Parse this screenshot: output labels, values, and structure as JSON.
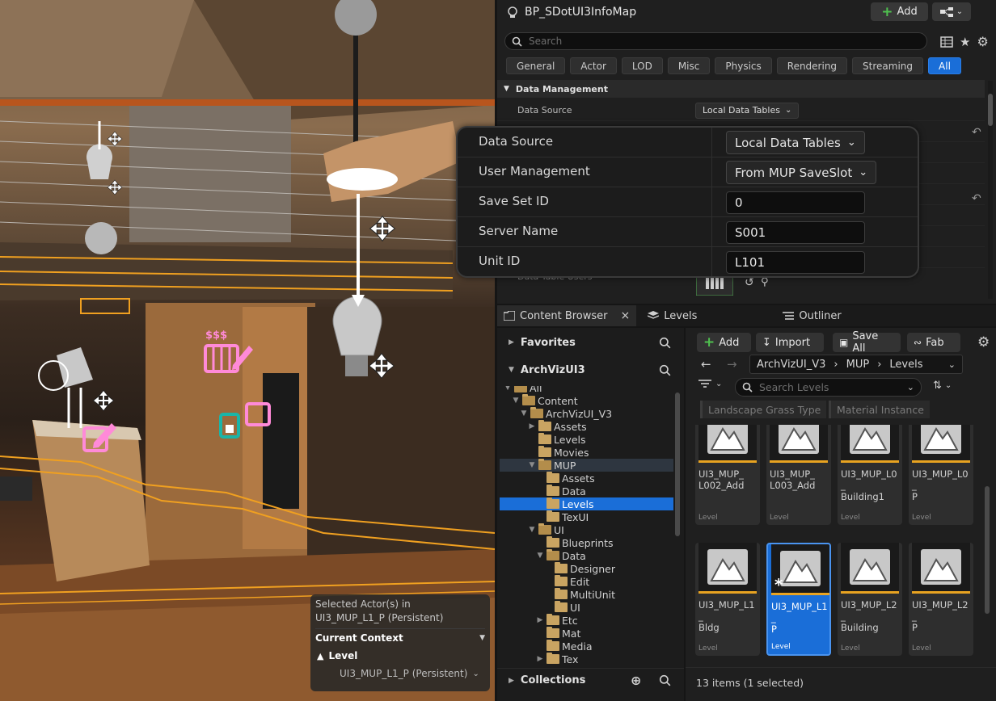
{
  "viewport": {
    "selected_actors_label": "Selected Actor(s) in",
    "selected_actors_level": "UI3_MUP_L1_P (Persistent)",
    "current_context": "Current Context",
    "level_label": "Level",
    "level_value": "UI3_MUP_L1_P (Persistent)",
    "overlay_text_money": "$$$",
    "overlay_text_dollar": "$"
  },
  "details": {
    "title": "BP_SDotUI3InfoMap",
    "add_label": "Add",
    "search_placeholder": "Search",
    "tabs": [
      {
        "label": "General"
      },
      {
        "label": "Actor"
      },
      {
        "label": "LOD"
      },
      {
        "label": "Misc"
      },
      {
        "label": "Physics"
      },
      {
        "label": "Rendering"
      },
      {
        "label": "Streaming"
      },
      {
        "label": "All"
      }
    ],
    "active_tab": "All",
    "section": "Data Management",
    "rows": [
      {
        "name": "Data Source",
        "value": "Local Data Tables"
      }
    ],
    "partial_row": "Data Table Users"
  },
  "zoom": {
    "rows": [
      {
        "label": "Data Source",
        "value": "Local Data Tables",
        "kind": "dropdown"
      },
      {
        "label": "User Management",
        "value": "From MUP SaveSlot",
        "kind": "dropdown"
      },
      {
        "label": "Save Set ID",
        "value": "0",
        "kind": "input"
      },
      {
        "label": "Server Name",
        "value": "S001",
        "kind": "input"
      },
      {
        "label": "Unit ID",
        "value": "L101",
        "kind": "input"
      }
    ]
  },
  "bottom_tabs": {
    "content_browser": "Content Browser",
    "levels": "Levels",
    "outliner": "Outliner"
  },
  "content_browser": {
    "favorites": "Favorites",
    "project": "ArchVizUI3",
    "collections": "Collections",
    "add_label": "Add",
    "import_label": "Import",
    "save_all_label": "Save All",
    "fab_label": "Fab",
    "path": [
      "ArchVizUI_V3",
      "MUP",
      "Levels"
    ],
    "search_placeholder": "Search Levels",
    "filters": [
      "Landscape Grass Type",
      "Material Instance"
    ],
    "tree": [
      {
        "label": "All",
        "depth": 0,
        "open": true
      },
      {
        "label": "Content",
        "depth": 1,
        "open": true
      },
      {
        "label": "ArchVizUI_V3",
        "depth": 2,
        "open": true
      },
      {
        "label": "Assets",
        "depth": 3,
        "open": false,
        "expandable": true
      },
      {
        "label": "Levels",
        "depth": 3,
        "open": false
      },
      {
        "label": "Movies",
        "depth": 3,
        "open": false
      },
      {
        "label": "MUP",
        "depth": 3,
        "open": true,
        "hover": true
      },
      {
        "label": "Assets",
        "depth": 4,
        "open": false
      },
      {
        "label": "Data",
        "depth": 4,
        "open": false
      },
      {
        "label": "Levels",
        "depth": 4,
        "open": false,
        "selected": true
      },
      {
        "label": "TexUI",
        "depth": 4,
        "open": false
      },
      {
        "label": "UI",
        "depth": 3,
        "open": true
      },
      {
        "label": "Blueprints",
        "depth": 4,
        "open": false
      },
      {
        "label": "Data",
        "depth": 4,
        "open": true
      },
      {
        "label": "Designer",
        "depth": 5,
        "open": false
      },
      {
        "label": "Edit",
        "depth": 5,
        "open": false
      },
      {
        "label": "MultiUnit",
        "depth": 5,
        "open": false
      },
      {
        "label": "UI",
        "depth": 5,
        "open": false
      },
      {
        "label": "Etc",
        "depth": 4,
        "open": false,
        "expandable": true
      },
      {
        "label": "Mat",
        "depth": 4,
        "open": false
      },
      {
        "label": "Media",
        "depth": 4,
        "open": false
      },
      {
        "label": "Tex",
        "depth": 4,
        "open": false,
        "expandable": true
      }
    ],
    "assets": [
      {
        "name": "UI3_MUP_\nL002_Add",
        "type": "Level"
      },
      {
        "name": "UI3_MUP_\nL003_Add",
        "type": "Level"
      },
      {
        "name": "UI3_MUP_L0_\nBuilding1",
        "type": "Level"
      },
      {
        "name": "UI3_MUP_L0_\nP",
        "type": "Level"
      },
      {
        "name": "UI3_MUP_L1_\nBldg",
        "type": "Level"
      },
      {
        "name": "UI3_MUP_L1_\nP",
        "type": "Level",
        "selected": true
      },
      {
        "name": "UI3_MUP_L2_\nBuilding",
        "type": "Level"
      },
      {
        "name": "UI3_MUP_L2_\nP",
        "type": "Level"
      }
    ],
    "status": "13 items (1 selected)"
  },
  "colors": {
    "accent_blue": "#1a6ed8",
    "selection_orange": "#f0a020",
    "folder": "#c9a462",
    "panel_bg": "#1f1f1f"
  }
}
